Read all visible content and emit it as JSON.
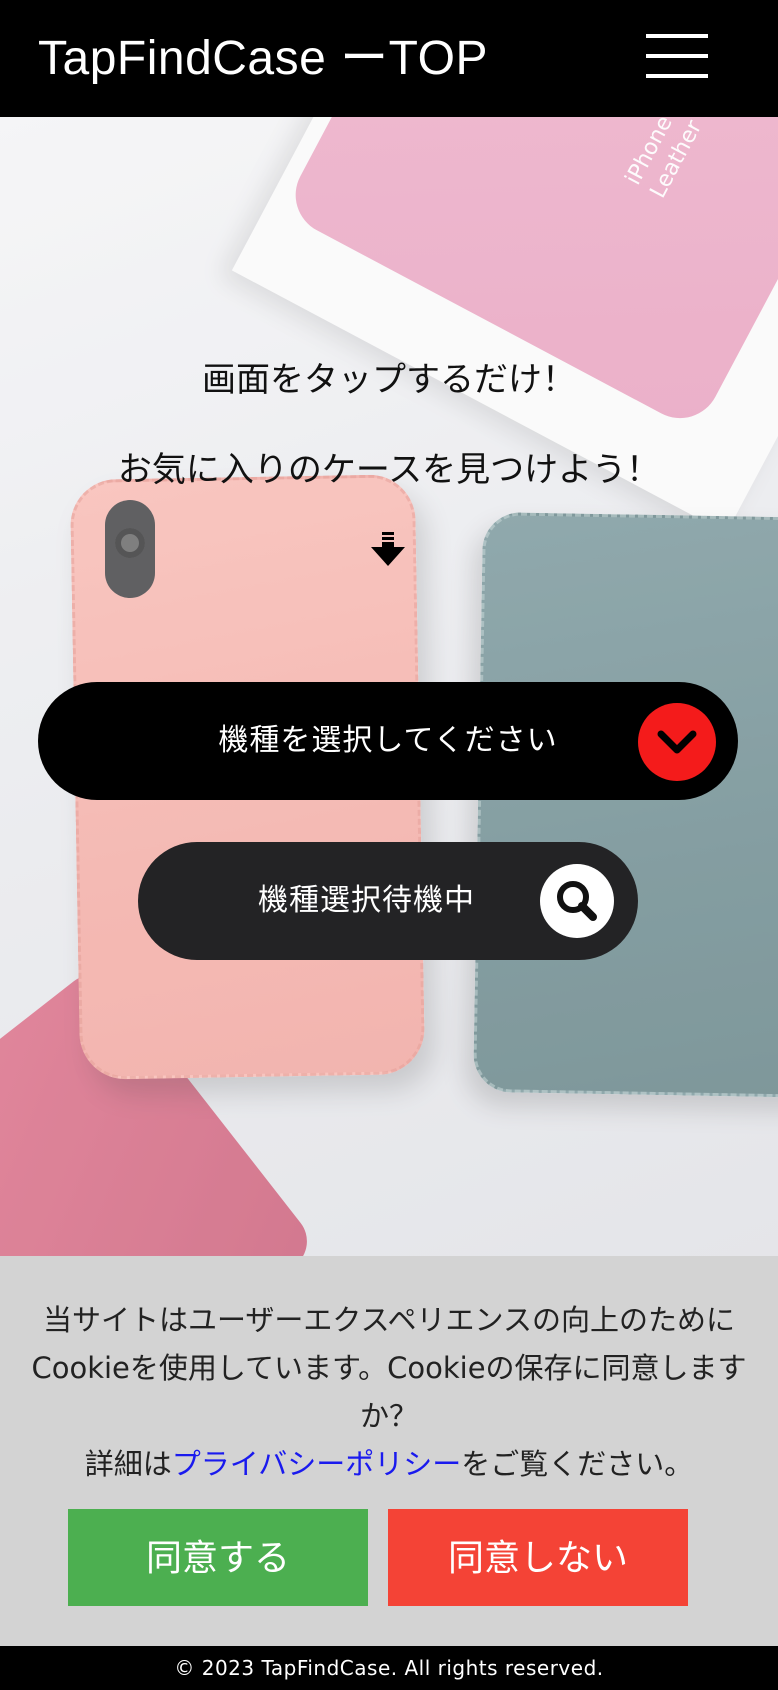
{
  "header": {
    "title": "TapFindCase ーTOP",
    "menu_icon": "hamburger-menu-icon"
  },
  "hero": {
    "background_box_text": "iPhone X\nLeather Folio",
    "line1": "画面をタップするだけ！",
    "line2": "お気に入りのケースを見つけよう！",
    "arrow_icon": "down-arrow-icon",
    "select": {
      "label": "機種を選択してください",
      "icon": "chevron-down-icon",
      "icon_bg": "#f41b1b"
    },
    "search": {
      "label": "機種選択待機中",
      "icon": "search-icon"
    }
  },
  "cookie_banner": {
    "message": "当サイトはユーザーエクスペリエンスの向上のためにCookieを使用しています。Cookieの保存に同意しますか？",
    "details_prefix": "詳細は",
    "privacy_link": "プライバシーポリシー",
    "details_suffix": "をご覧ください。",
    "agree_label": "同意する",
    "decline_label": "同意しない",
    "agree_color": "#4caf50",
    "decline_color": "#f44336"
  },
  "footer": {
    "copyright": "© 2023 TapFindCase. All rights reserved."
  }
}
